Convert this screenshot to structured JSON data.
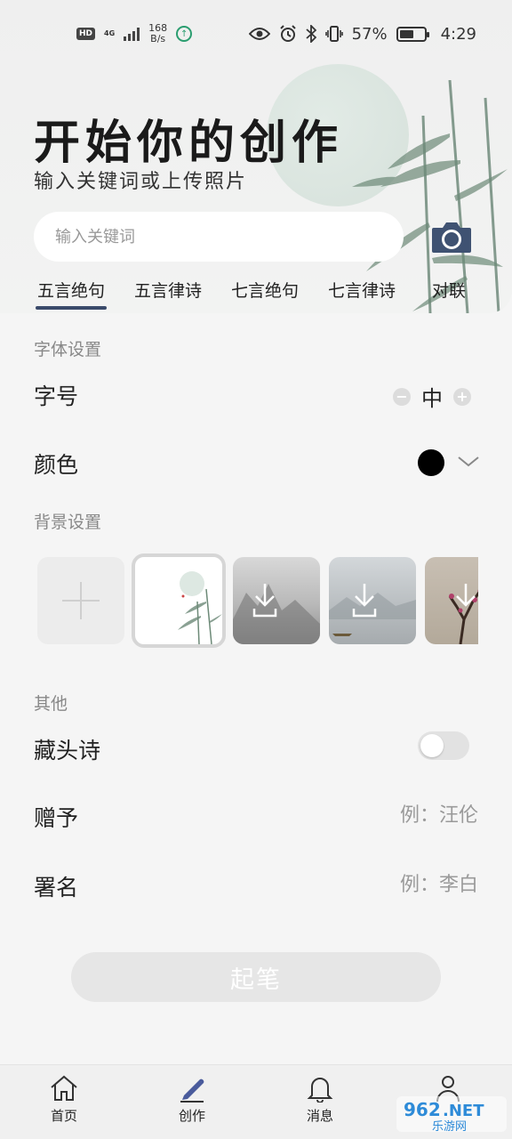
{
  "status_bar": {
    "hd": "HD",
    "network": "4G",
    "speed_value": "168",
    "speed_unit": "B/s",
    "battery_percent": "57%",
    "battery_level": 0.57,
    "time": "4:29"
  },
  "header": {
    "title": "开始你的创作",
    "subtitle": "输入关键词或上传照片",
    "search_placeholder": "输入关键词"
  },
  "tabs": [
    {
      "label": "五言绝句",
      "active": true
    },
    {
      "label": "五言律诗",
      "active": false
    },
    {
      "label": "七言绝句",
      "active": false
    },
    {
      "label": "七言律诗",
      "active": false
    },
    {
      "label": "对联",
      "active": false
    }
  ],
  "font_settings": {
    "section_label": "字体设置",
    "size_label": "字号",
    "size_value": "中",
    "color_label": "颜色",
    "color_value": "#000000"
  },
  "background_settings": {
    "section_label": "背景设置",
    "thumbnails": [
      "add",
      "bamboo-moon",
      "mountain-landscape",
      "lake-boat",
      "plum-blossom"
    ],
    "selected_index": 1
  },
  "other": {
    "section_label": "其他",
    "acrostic_label": "藏头诗",
    "acrostic_enabled": false,
    "gift_label": "赠予",
    "gift_placeholder": "例：汪伦",
    "signature_label": "署名",
    "signature_placeholder": "例：李白"
  },
  "submit_label": "起笔",
  "bottom_nav": [
    {
      "label": "首页",
      "icon": "home-icon"
    },
    {
      "label": "创作",
      "icon": "pen-icon"
    },
    {
      "label": "消息",
      "icon": "bell-icon"
    },
    {
      "label": "",
      "icon": "profile-icon"
    }
  ],
  "watermark": "962.NET 乐游网"
}
